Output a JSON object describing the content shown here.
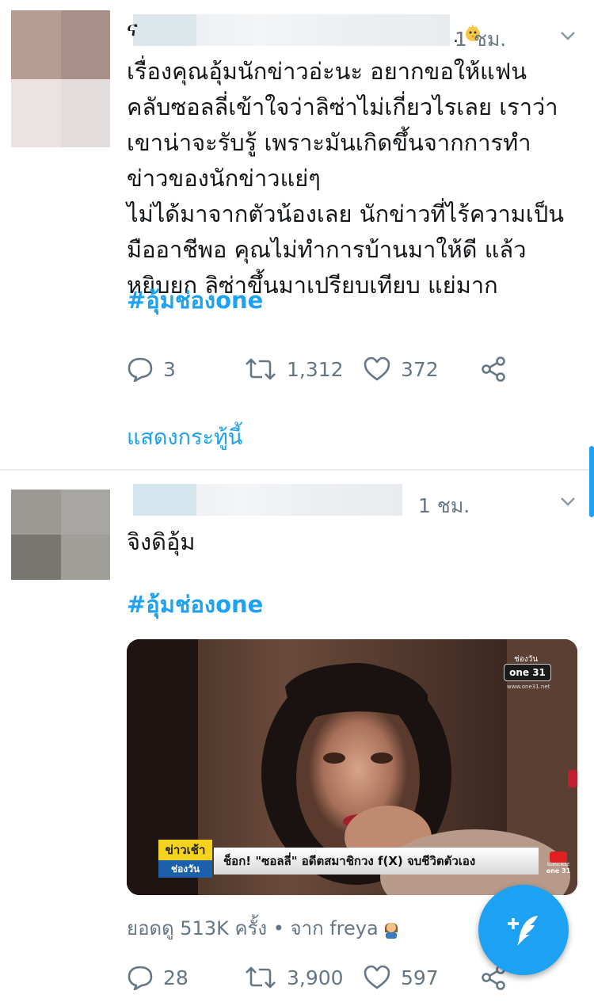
{
  "colors": {
    "accent": "#1da1f2",
    "secondary_text": "#657786",
    "primary_text": "#14171a"
  },
  "tweets": [
    {
      "name_visible": "ና",
      "time": "1 ชม.",
      "body_lines": [
        "เรื่องคุณอุ้มนักข่าวอ่ะนะ อยากขอให้แฟน",
        "คลับซอลลี่เข้าใจว่าลิซ่าไม่เกี่ยวไรเลย เราว่า",
        "เขาน่าจะรับรู้ เพราะมันเกิดขึ้นจากการทำ",
        "ข่าวของนักข่าวแย่ๆ",
        "ไม่ได้มาจากตัวน้องเลย นักข่าวที่ไร้ความเป็น",
        "มืออาชีพอ คุณไม่ทำการบ้านมาให้ดี แล้ว",
        "หยิบยก ลิซ่าขึ้นมาเปรียบเทียบ แย่มาก"
      ],
      "hashtag": "#อุ้มช่องone",
      "replies": "3",
      "retweets": "1,312",
      "likes": "372",
      "show_thread": "แสดงกระทู้นี้"
    },
    {
      "time": "1 ชม.",
      "body": "จิงดิอุ้ม",
      "hashtag": "#อุ้มช่องone",
      "media": {
        "channel_label": "ช่องวัน",
        "channel_logo": "one 31",
        "channel_url": "www.one31.net",
        "news_tag_top": "ข่าวเช้า",
        "news_tag_bottom": "ช่องวัน",
        "headline": "ช็อก! \"ซอลลี่\" อดีตสมาชิกวง f(X) จบชีวิตตัวเอง",
        "subscribe": "SUBSCRIBE",
        "sub_logo": "one 31"
      },
      "views_text": "ยอดดู 513K ครั้ง • จาก freya",
      "replies": "28",
      "retweets": "3,900",
      "likes": "597"
    }
  ]
}
